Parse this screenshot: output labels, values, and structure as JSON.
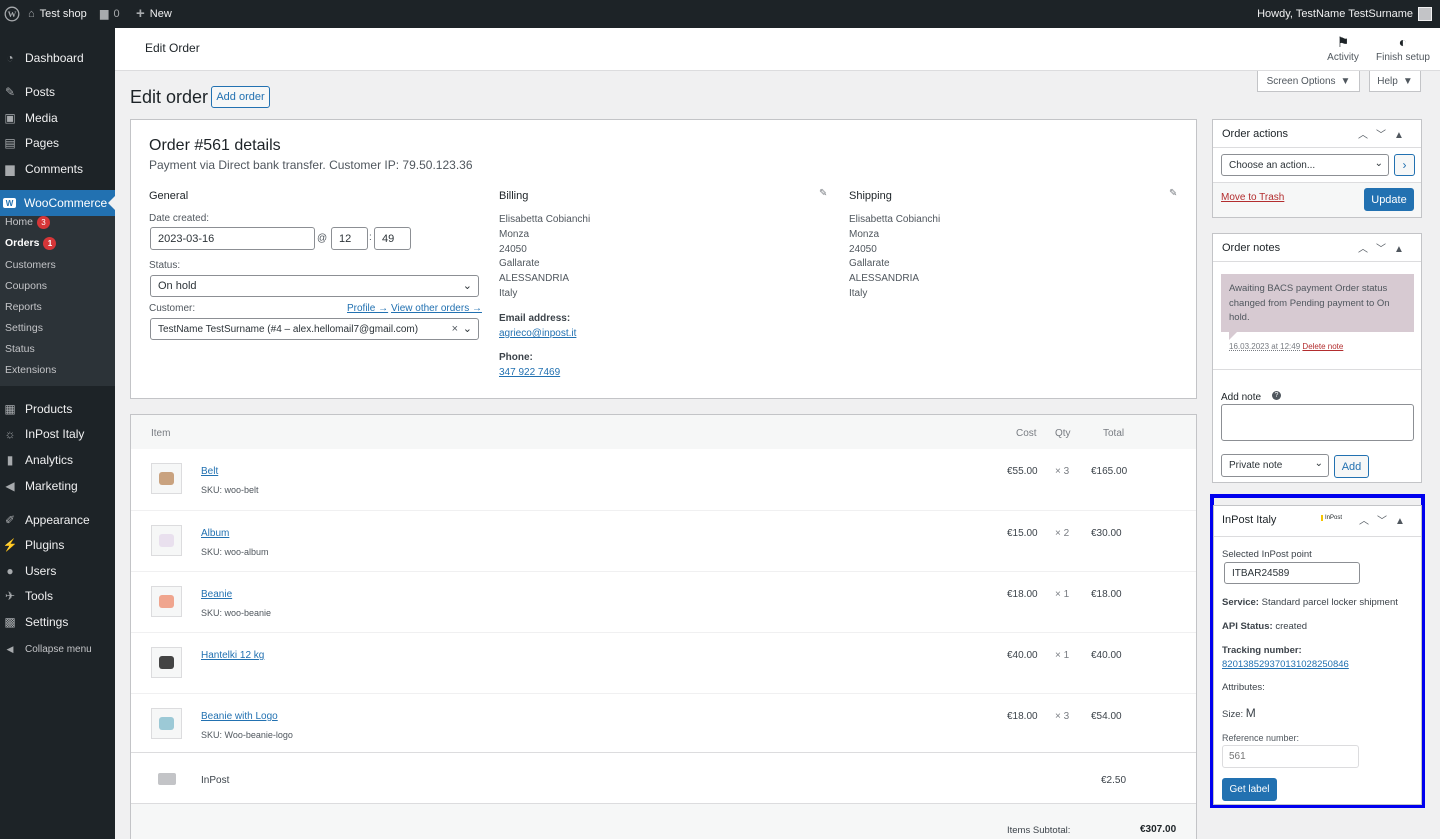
{
  "admin_bar": {
    "site_name": "Test shop",
    "comments_count": "0",
    "new_label": "New",
    "howdy": "Howdy, TestName TestSurname"
  },
  "sidebar": {
    "items": [
      {
        "label": "Dashboard",
        "icon": "dashboard-icon"
      },
      {
        "label": "Posts",
        "icon": "pin-icon"
      },
      {
        "label": "Media",
        "icon": "media-icon"
      },
      {
        "label": "Pages",
        "icon": "pages-icon"
      },
      {
        "label": "Comments",
        "icon": "comment-icon"
      },
      {
        "label": "WooCommerce",
        "icon": "woo-icon"
      },
      {
        "label": "Products",
        "icon": "products-icon"
      },
      {
        "label": "InPost Italy",
        "icon": "sun-icon"
      },
      {
        "label": "Analytics",
        "icon": "analytics-icon"
      },
      {
        "label": "Marketing",
        "icon": "megaphone-icon"
      },
      {
        "label": "Appearance",
        "icon": "brush-icon"
      },
      {
        "label": "Plugins",
        "icon": "plugin-icon"
      },
      {
        "label": "Users",
        "icon": "user-icon"
      },
      {
        "label": "Tools",
        "icon": "wrench-icon"
      },
      {
        "label": "Settings",
        "icon": "settings-icon"
      },
      {
        "label": "Collapse menu",
        "icon": "collapse-icon"
      }
    ],
    "woo_submenu": [
      {
        "label": "Home",
        "badge": "3"
      },
      {
        "label": "Orders",
        "badge": "1"
      },
      {
        "label": "Customers"
      },
      {
        "label": "Coupons"
      },
      {
        "label": "Reports"
      },
      {
        "label": "Settings"
      },
      {
        "label": "Status"
      },
      {
        "label": "Extensions"
      }
    ]
  },
  "header": {
    "title": "Edit Order",
    "activity": "Activity",
    "finish_setup": "Finish setup",
    "screen_options": "Screen Options",
    "help": "Help"
  },
  "page": {
    "title": "Edit order",
    "add_order": "Add order"
  },
  "order": {
    "heading": "Order #561 details",
    "subheading": "Payment via Direct bank transfer. Customer IP: 79.50.123.36",
    "general": {
      "title": "General",
      "date_label": "Date created:",
      "date": "2023-03-16",
      "at": "@",
      "hour": "12",
      "colon": ":",
      "minute": "49",
      "status_label": "Status:",
      "status": "On hold",
      "customer_label": "Customer:",
      "profile_link": "Profile →",
      "view_orders_link": "View other orders →",
      "customer": "TestName TestSurname (#4 – alex.hellomail7@gmail.com)"
    },
    "billing": {
      "title": "Billing",
      "lines": [
        "Elisabetta Cobianchi",
        "Monza",
        "24050",
        "Gallarate",
        "ALESSANDRIA",
        "Italy"
      ],
      "email_label": "Email address:",
      "email": "agrieco@inpost.it",
      "phone_label": "Phone:",
      "phone": "347 922 7469"
    },
    "shipping": {
      "title": "Shipping",
      "lines": [
        "Elisabetta Cobianchi",
        "Monza",
        "24050",
        "Gallarate",
        "ALESSANDRIA",
        "Italy"
      ]
    }
  },
  "items": {
    "headers": {
      "item": "Item",
      "cost": "Cost",
      "qty": "Qty",
      "total": "Total"
    },
    "rows": [
      {
        "name": "Belt",
        "sku": "SKU: woo-belt",
        "cost": "€55.00",
        "qty": "× 3",
        "total": "€165.00"
      },
      {
        "name": "Album",
        "sku": "SKU: woo-album",
        "cost": "€15.00",
        "qty": "× 2",
        "total": "€30.00"
      },
      {
        "name": "Beanie",
        "sku": "SKU: woo-beanie",
        "cost": "€18.00",
        "qty": "× 1",
        "total": "€18.00"
      },
      {
        "name": "Hantelki 12 kg",
        "sku": "",
        "cost": "€40.00",
        "qty": "× 1",
        "total": "€40.00"
      },
      {
        "name": "Beanie with Logo",
        "sku": "SKU: Woo-beanie-logo",
        "cost": "€18.00",
        "qty": "× 3",
        "total": "€54.00"
      }
    ],
    "shipping": {
      "name": "InPost",
      "total": "€2.50"
    },
    "subtotal_label": "Items Subtotal:",
    "subtotal": "€307.00"
  },
  "order_actions": {
    "title": "Order actions",
    "select": "Choose an action...",
    "trash": "Move to Trash",
    "update": "Update"
  },
  "order_notes": {
    "title": "Order notes",
    "note": "Awaiting BACS payment Order status changed from Pending payment to On hold.",
    "note_meta": "16.03.2023 at 12:49",
    "delete": "Delete note",
    "add_note_label": "Add note",
    "note_type": "Private note",
    "add": "Add"
  },
  "inpost": {
    "title": "InPost Italy",
    "logo_text": "InPost",
    "point_label": "Selected InPost point",
    "point": "ITBAR24589",
    "service_label": "Service:",
    "service": "Standard parcel locker shipment",
    "api_label": "API Status:",
    "api": "created",
    "tracking_label": "Tracking number:",
    "tracking": "820138529370131028250846",
    "attributes": "Attributes:",
    "size_label": "Size:",
    "size": "M",
    "ref_label": "Reference number:",
    "ref_placeholder": "561",
    "get_label": "Get label",
    "highlight": "#0000ee"
  }
}
